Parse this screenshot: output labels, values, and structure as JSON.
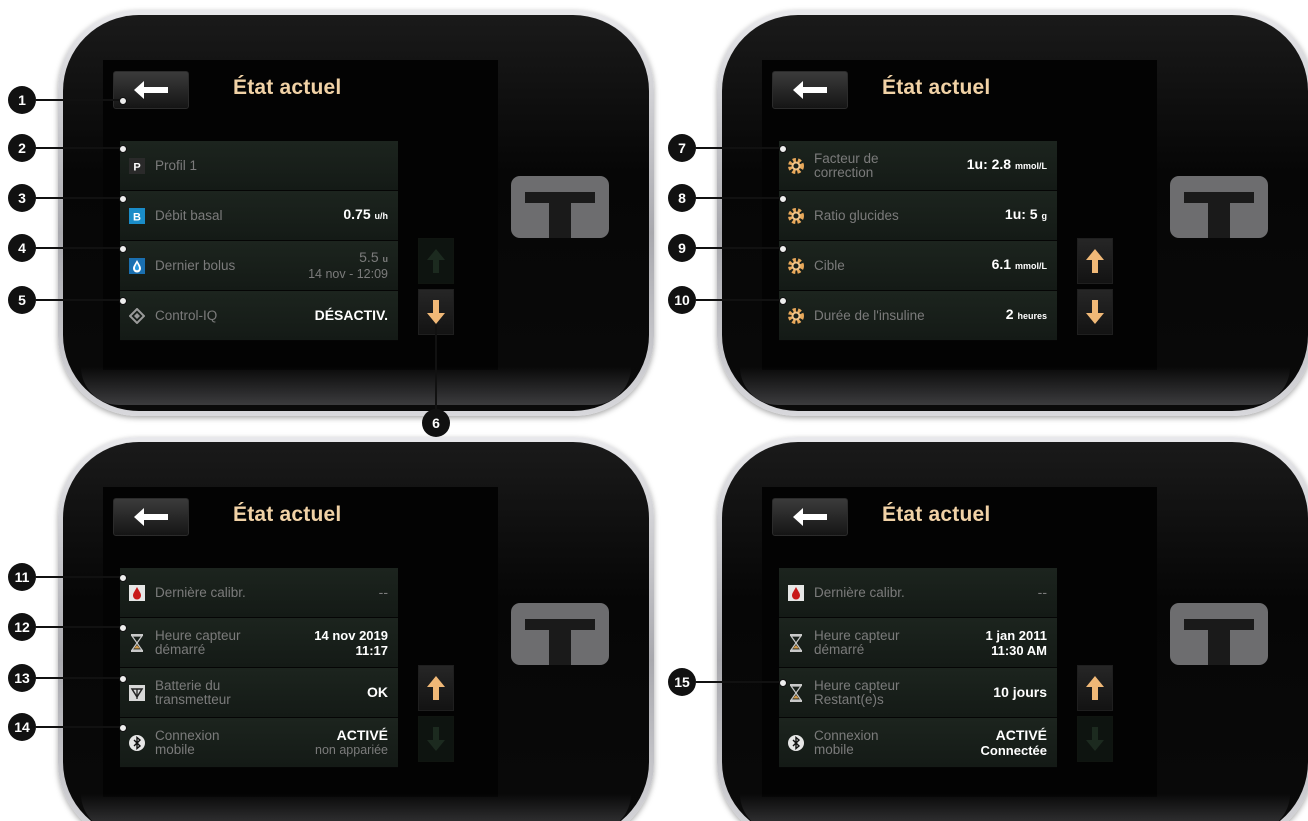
{
  "panels": [
    {
      "title": "État actuel",
      "rows": [
        {
          "icon": "profile-p-icon",
          "label": "Profil 1",
          "value": ""
        },
        {
          "icon": "basal-b-icon",
          "label": "Débit basal",
          "value_main": "0.75",
          "value_unit": "u/h"
        },
        {
          "icon": "bolus-drop-icon",
          "label": "Dernier bolus",
          "value_main": "5.5",
          "value_unit": "u",
          "value_sub": "14 nov - 12:09"
        },
        {
          "icon": "control-iq-icon",
          "label": "Control-IQ",
          "value": "DÉSACTIV."
        }
      ]
    },
    {
      "title": "État actuel",
      "rows": [
        {
          "icon": "gear-icon",
          "label_1": "Facteur de",
          "label_2": "correction",
          "value_main": "1u: 2.8",
          "value_unit": "mmol/L"
        },
        {
          "icon": "gear-icon",
          "label": "Ratio glucides",
          "value_main": "1u: 5",
          "value_unit": "g"
        },
        {
          "icon": "gear-icon",
          "label": "Cible",
          "value_main": "6.1",
          "value_unit": "mmol/L"
        },
        {
          "icon": "gear-icon",
          "label": "Durée de l'insuline",
          "value_main": "2",
          "value_unit": "heures"
        }
      ]
    },
    {
      "title": "État actuel",
      "rows": [
        {
          "icon": "blood-drop-icon",
          "label": "Dernière calibr.",
          "value": "--"
        },
        {
          "icon": "hourglass-icon",
          "label_1": "Heure capteur",
          "label_2": "démarré",
          "value_1": "14 nov 2019",
          "value_2": "11:17"
        },
        {
          "icon": "transmitter-icon",
          "label_1": "Batterie du",
          "label_2": "transmetteur",
          "value": "OK"
        },
        {
          "icon": "bluetooth-icon",
          "label_1": "Connexion",
          "label_2": "mobile",
          "value_1": "ACTIVÉ",
          "value_2": "non appariée"
        }
      ]
    },
    {
      "title": "État actuel",
      "rows": [
        {
          "icon": "blood-drop-icon",
          "label": "Dernière calibr.",
          "value": "--"
        },
        {
          "icon": "hourglass-icon",
          "label_1": "Heure capteur",
          "label_2": "démarré",
          "value_1": "1 jan 2011",
          "value_2": "11:30 AM"
        },
        {
          "icon": "hourglass-icon",
          "label_1": "Heure capteur",
          "label_2": "Restant(e)s",
          "value": "10 jours"
        },
        {
          "icon": "bluetooth-icon",
          "label_1": "Connexion",
          "label_2": "mobile",
          "value_1": "ACTIVÉ",
          "value_2": "Connectée"
        }
      ]
    }
  ],
  "callouts": [
    "1",
    "2",
    "3",
    "4",
    "5",
    "6",
    "7",
    "8",
    "9",
    "10",
    "11",
    "12",
    "13",
    "14",
    "15"
  ],
  "colors": {
    "title": "#f1d2a6",
    "arrow_up_active": "#f0b877",
    "arrow_down_active": "#f0b877",
    "row_bg": "#1a211c"
  }
}
